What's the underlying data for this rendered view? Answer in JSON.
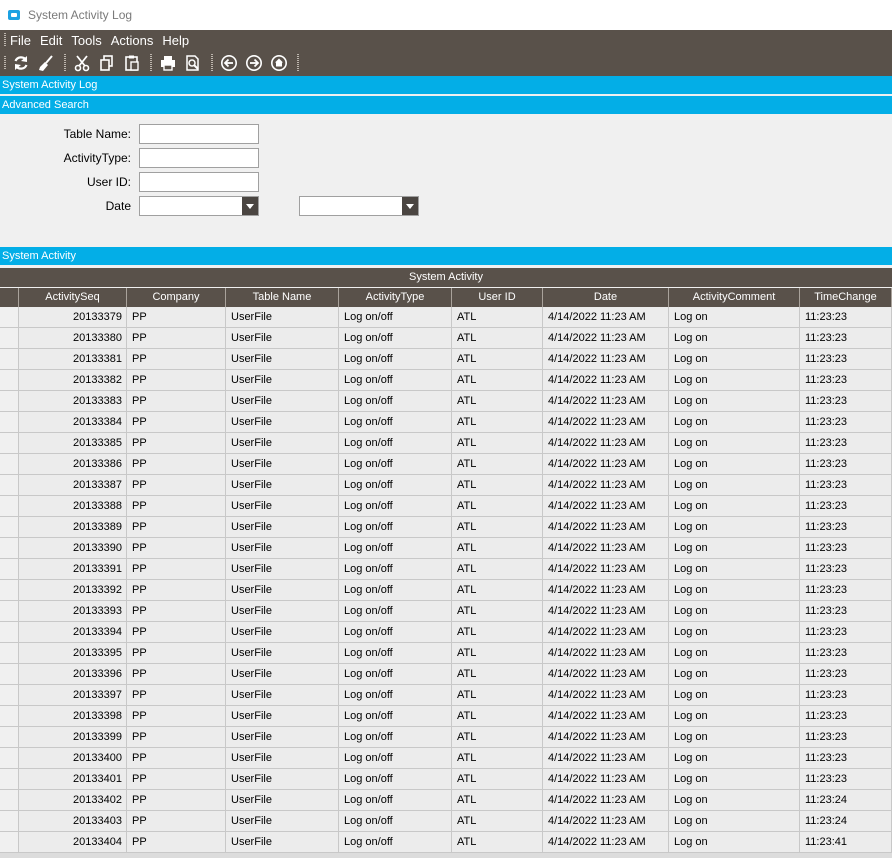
{
  "window": {
    "title": "System Activity Log"
  },
  "menu": {
    "items": [
      "File",
      "Edit",
      "Tools",
      "Actions",
      "Help"
    ]
  },
  "toolbar": {
    "icons": [
      "refresh-icon",
      "clear-icon",
      "cut-icon",
      "copy-icon",
      "paste-icon",
      "print-icon",
      "print-preview-icon",
      "back-icon",
      "forward-icon",
      "home-icon"
    ]
  },
  "sections": {
    "main": "System Activity Log",
    "search": "Advanced Search",
    "results": "System Activity"
  },
  "search": {
    "table_name_label": "Table Name:",
    "table_name_value": "",
    "activity_type_label": "ActivityType:",
    "activity_type_value": "",
    "user_id_label": "User ID:",
    "user_id_value": "",
    "date_label": "Date",
    "date_from_value": "",
    "date_to_value": ""
  },
  "grid": {
    "caption": "System Activity",
    "columns": [
      "ActivitySeq",
      "Company",
      "Table Name",
      "ActivityType",
      "User ID",
      "Date",
      "ActivityComment",
      "TimeChange"
    ],
    "rows": [
      [
        "20133379",
        "PP",
        "UserFile",
        "Log on/off",
        "ATL",
        "4/14/2022 11:23 AM",
        "Log on",
        "11:23:23"
      ],
      [
        "20133380",
        "PP",
        "UserFile",
        "Log on/off",
        "ATL",
        "4/14/2022 11:23 AM",
        "Log on",
        "11:23:23"
      ],
      [
        "20133381",
        "PP",
        "UserFile",
        "Log on/off",
        "ATL",
        "4/14/2022 11:23 AM",
        "Log on",
        "11:23:23"
      ],
      [
        "20133382",
        "PP",
        "UserFile",
        "Log on/off",
        "ATL",
        "4/14/2022 11:23 AM",
        "Log on",
        "11:23:23"
      ],
      [
        "20133383",
        "PP",
        "UserFile",
        "Log on/off",
        "ATL",
        "4/14/2022 11:23 AM",
        "Log on",
        "11:23:23"
      ],
      [
        "20133384",
        "PP",
        "UserFile",
        "Log on/off",
        "ATL",
        "4/14/2022 11:23 AM",
        "Log on",
        "11:23:23"
      ],
      [
        "20133385",
        "PP",
        "UserFile",
        "Log on/off",
        "ATL",
        "4/14/2022 11:23 AM",
        "Log on",
        "11:23:23"
      ],
      [
        "20133386",
        "PP",
        "UserFile",
        "Log on/off",
        "ATL",
        "4/14/2022 11:23 AM",
        "Log on",
        "11:23:23"
      ],
      [
        "20133387",
        "PP",
        "UserFile",
        "Log on/off",
        "ATL",
        "4/14/2022 11:23 AM",
        "Log on",
        "11:23:23"
      ],
      [
        "20133388",
        "PP",
        "UserFile",
        "Log on/off",
        "ATL",
        "4/14/2022 11:23 AM",
        "Log on",
        "11:23:23"
      ],
      [
        "20133389",
        "PP",
        "UserFile",
        "Log on/off",
        "ATL",
        "4/14/2022 11:23 AM",
        "Log on",
        "11:23:23"
      ],
      [
        "20133390",
        "PP",
        "UserFile",
        "Log on/off",
        "ATL",
        "4/14/2022 11:23 AM",
        "Log on",
        "11:23:23"
      ],
      [
        "20133391",
        "PP",
        "UserFile",
        "Log on/off",
        "ATL",
        "4/14/2022 11:23 AM",
        "Log on",
        "11:23:23"
      ],
      [
        "20133392",
        "PP",
        "UserFile",
        "Log on/off",
        "ATL",
        "4/14/2022 11:23 AM",
        "Log on",
        "11:23:23"
      ],
      [
        "20133393",
        "PP",
        "UserFile",
        "Log on/off",
        "ATL",
        "4/14/2022 11:23 AM",
        "Log on",
        "11:23:23"
      ],
      [
        "20133394",
        "PP",
        "UserFile",
        "Log on/off",
        "ATL",
        "4/14/2022 11:23 AM",
        "Log on",
        "11:23:23"
      ],
      [
        "20133395",
        "PP",
        "UserFile",
        "Log on/off",
        "ATL",
        "4/14/2022 11:23 AM",
        "Log on",
        "11:23:23"
      ],
      [
        "20133396",
        "PP",
        "UserFile",
        "Log on/off",
        "ATL",
        "4/14/2022 11:23 AM",
        "Log on",
        "11:23:23"
      ],
      [
        "20133397",
        "PP",
        "UserFile",
        "Log on/off",
        "ATL",
        "4/14/2022 11:23 AM",
        "Log on",
        "11:23:23"
      ],
      [
        "20133398",
        "PP",
        "UserFile",
        "Log on/off",
        "ATL",
        "4/14/2022 11:23 AM",
        "Log on",
        "11:23:23"
      ],
      [
        "20133399",
        "PP",
        "UserFile",
        "Log on/off",
        "ATL",
        "4/14/2022 11:23 AM",
        "Log on",
        "11:23:23"
      ],
      [
        "20133400",
        "PP",
        "UserFile",
        "Log on/off",
        "ATL",
        "4/14/2022 11:23 AM",
        "Log on",
        "11:23:23"
      ],
      [
        "20133401",
        "PP",
        "UserFile",
        "Log on/off",
        "ATL",
        "4/14/2022 11:23 AM",
        "Log on",
        "11:23:23"
      ],
      [
        "20133402",
        "PP",
        "UserFile",
        "Log on/off",
        "ATL",
        "4/14/2022 11:23 AM",
        "Log on",
        "11:23:24"
      ],
      [
        "20133403",
        "PP",
        "UserFile",
        "Log on/off",
        "ATL",
        "4/14/2022 11:23 AM",
        "Log on",
        "11:23:24"
      ],
      [
        "20133404",
        "PP",
        "UserFile",
        "Log on/off",
        "ATL",
        "4/14/2022 11:23 AM",
        "Log on",
        "11:23:41"
      ]
    ]
  },
  "colors": {
    "accent": "#03aee7",
    "chrome": "#59514a",
    "cell": "#ececec"
  }
}
